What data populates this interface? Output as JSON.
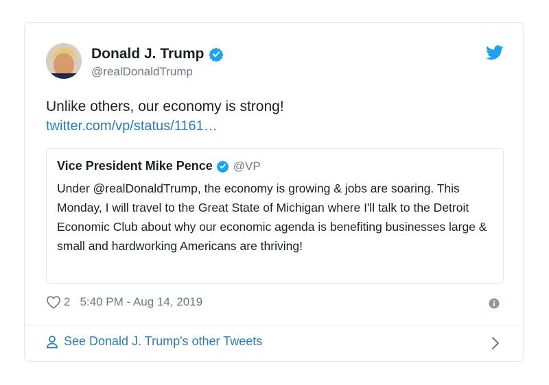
{
  "tweet": {
    "author_name": "Donald J. Trump",
    "author_handle": "@realDonaldTrump",
    "text": "Unlike others, our economy is strong!",
    "link_text": "twitter.com/vp/status/1161…",
    "like_count": "2",
    "timestamp": "5:40 PM - Aug 14, 2019"
  },
  "quoted_tweet": {
    "author_name": "Vice President Mike Pence",
    "author_handle": "@VP",
    "text": "Under @realDonaldTrump, the economy is growing & jobs are soaring. This Monday, I will travel to the Great State of Michigan where I'll talk to the Detroit Economic Club about why our economic agenda is benefiting businesses large & small and hardworking Americans are thriving!"
  },
  "footer": {
    "see_more_label": "See Donald J. Trump's other Tweets"
  },
  "icons": {
    "verified": "verified-badge-icon",
    "twitter": "twitter-bird-icon",
    "like": "heart-icon",
    "info": "info-icon",
    "person": "person-icon",
    "chevron": "chevron-right-icon"
  },
  "colors": {
    "link": "#2b7bb9",
    "verified": "#1da1f2",
    "muted": "#697882",
    "border": "#e1e8ed"
  }
}
